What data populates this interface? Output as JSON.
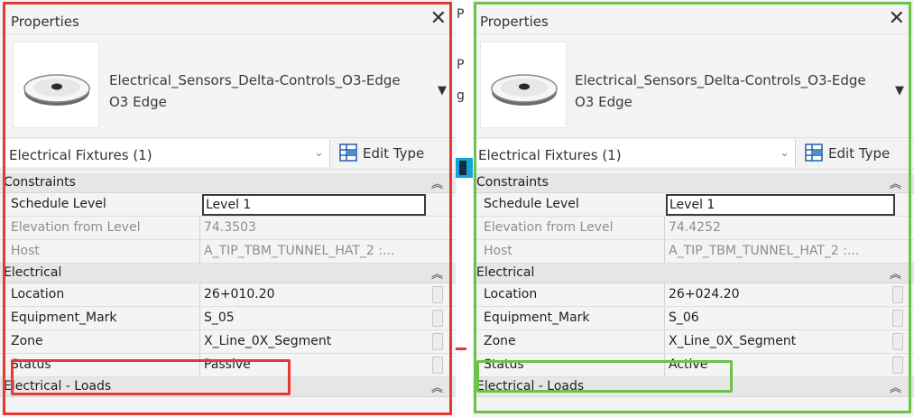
{
  "left_panel": {
    "title": "Properties",
    "close_glyph": "✕",
    "type_name": "Electrical_Sensors_Delta-Controls_O3-Edge",
    "type_subname": "O3 Edge",
    "category_selector": "Electrical Fixtures (1)",
    "edit_type_label": "Edit Type",
    "sections": {
      "constraints": "Constraints",
      "electrical": "Electrical",
      "electrical_loads": "Electrical - Loads"
    },
    "properties": {
      "schedule_level": {
        "label": "Schedule Level",
        "value": "Level 1"
      },
      "elevation": {
        "label": "Elevation from Level",
        "value": "74.3503"
      },
      "host": {
        "label": "Host",
        "value": "A_TIP_TBM_TUNNEL_HAT_2 :..."
      },
      "location": {
        "label": "Location",
        "value": "26+010.20"
      },
      "equipment_mark": {
        "label": "Equipment_Mark",
        "value": "S_05"
      },
      "zone": {
        "label": "Zone",
        "value": "X_Line_0X_Segment"
      },
      "status": {
        "label": "Status",
        "value": "Passive"
      }
    },
    "highlight_color": "#e53935"
  },
  "right_panel": {
    "title": "Properties",
    "close_glyph": "✕",
    "type_name": "Electrical_Sensors_Delta-Controls_O3-Edge",
    "type_subname": "O3 Edge",
    "category_selector": "Electrical Fixtures (1)",
    "edit_type_label": "Edit Type",
    "sections": {
      "constraints": "Constraints",
      "electrical": "Electrical",
      "electrical_loads": "Electrical - Loads"
    },
    "properties": {
      "schedule_level": {
        "label": "Schedule Level",
        "value": "Level 1"
      },
      "elevation": {
        "label": "Elevation from Level",
        "value": "74.4252"
      },
      "host": {
        "label": "Host",
        "value": "A_TIP_TBM_TUNNEL_HAT_2 :..."
      },
      "location": {
        "label": "Location",
        "value": "26+024.20"
      },
      "equipment_mark": {
        "label": "Equipment_Mark",
        "value": "S_06"
      },
      "zone": {
        "label": "Zone",
        "value": "X_Line_0X_Segment"
      },
      "status": {
        "label": "Status",
        "value": "Active"
      }
    },
    "highlight_color": "#6cc24a"
  },
  "background_fragments": [
    "P",
    "P",
    "g"
  ],
  "icons": {
    "close": "close-icon",
    "type_dropdown": "chevron-down-icon",
    "category_dropdown": "chevron-down-icon",
    "edit_type": "edit-type-icon",
    "section_collapse": "double-chevron-up-icon",
    "thumbnail": "sensor-thumbnail-icon"
  }
}
